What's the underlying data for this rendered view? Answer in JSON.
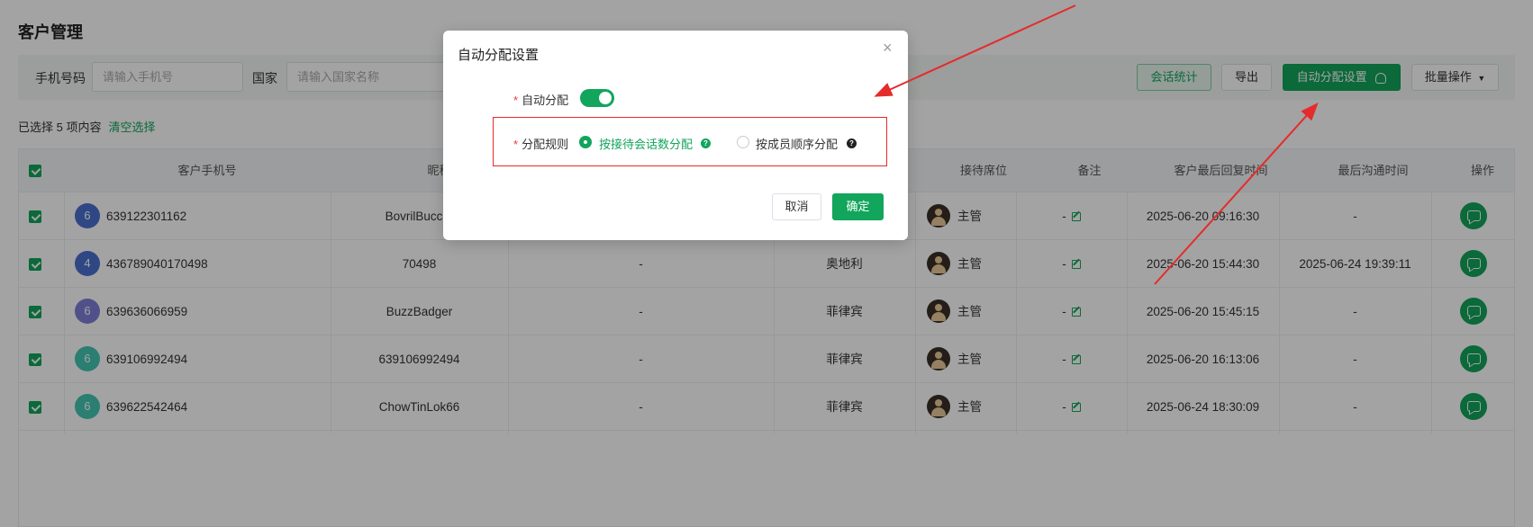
{
  "page": {
    "title": "客户管理"
  },
  "filters": {
    "phone_label": "手机号码",
    "phone_placeholder": "请输入手机号",
    "country_label": "国家",
    "country_placeholder": "请输入国家名称"
  },
  "toolbar": {
    "session_stats": "会话统计",
    "export": "导出",
    "auto_assign_settings": "自动分配设置",
    "batch_ops": "批量操作"
  },
  "selection": {
    "info": "已选择 5 项内容",
    "clear": "清空选择"
  },
  "table": {
    "columns": {
      "phone": "客户手机号",
      "nickname": "昵称",
      "seat": "接待席位",
      "remark": "备注",
      "last_reply": "客户最后回复时间",
      "last_contact": "最后沟通时间",
      "actions": "操作"
    },
    "rows": [
      {
        "avatar": "6",
        "avatar_color": "#4a6fcf",
        "phone": "639122301162",
        "nickname": "BovrilBuccar",
        "col3": "",
        "country": "",
        "seat": "主管",
        "remark": "-",
        "last_reply": "2025-06-20 09:16:30",
        "last_contact": "-"
      },
      {
        "avatar": "4",
        "avatar_color": "#4a6fcf",
        "phone": "436789040170498",
        "nickname": "70498",
        "col3": "-",
        "country": "奥地利",
        "seat": "主管",
        "remark": "-",
        "last_reply": "2025-06-20 15:44:30",
        "last_contact": "2025-06-24 19:39:11"
      },
      {
        "avatar": "6",
        "avatar_color": "#7f7fd8",
        "phone": "639636066959",
        "nickname": "BuzzBadger",
        "col3": "-",
        "country": "菲律宾",
        "seat": "主管",
        "remark": "-",
        "last_reply": "2025-06-20 15:45:15",
        "last_contact": "-"
      },
      {
        "avatar": "6",
        "avatar_color": "#44c6b2",
        "phone": "639106992494",
        "nickname": "639106992494",
        "col3": "-",
        "country": "菲律宾",
        "seat": "主管",
        "remark": "-",
        "last_reply": "2025-06-20 16:13:06",
        "last_contact": "-"
      },
      {
        "avatar": "6",
        "avatar_color": "#44c6b2",
        "phone": "639622542464",
        "nickname": "ChowTinLok66",
        "col3": "-",
        "country": "菲律宾",
        "seat": "主管",
        "remark": "-",
        "last_reply": "2025-06-24 18:30:09",
        "last_contact": "-"
      }
    ]
  },
  "modal": {
    "title": "自动分配设置",
    "auto_assign_label": "自动分配",
    "auto_assign_on": true,
    "rule_label": "分配规则",
    "option_sessions": "按接待会话数分配",
    "option_order": "按成员顺序分配",
    "help_glyph": "?",
    "cancel": "取消",
    "confirm": "确定"
  },
  "colors": {
    "accent": "#12a55c",
    "annotation": "#e52b2b"
  }
}
